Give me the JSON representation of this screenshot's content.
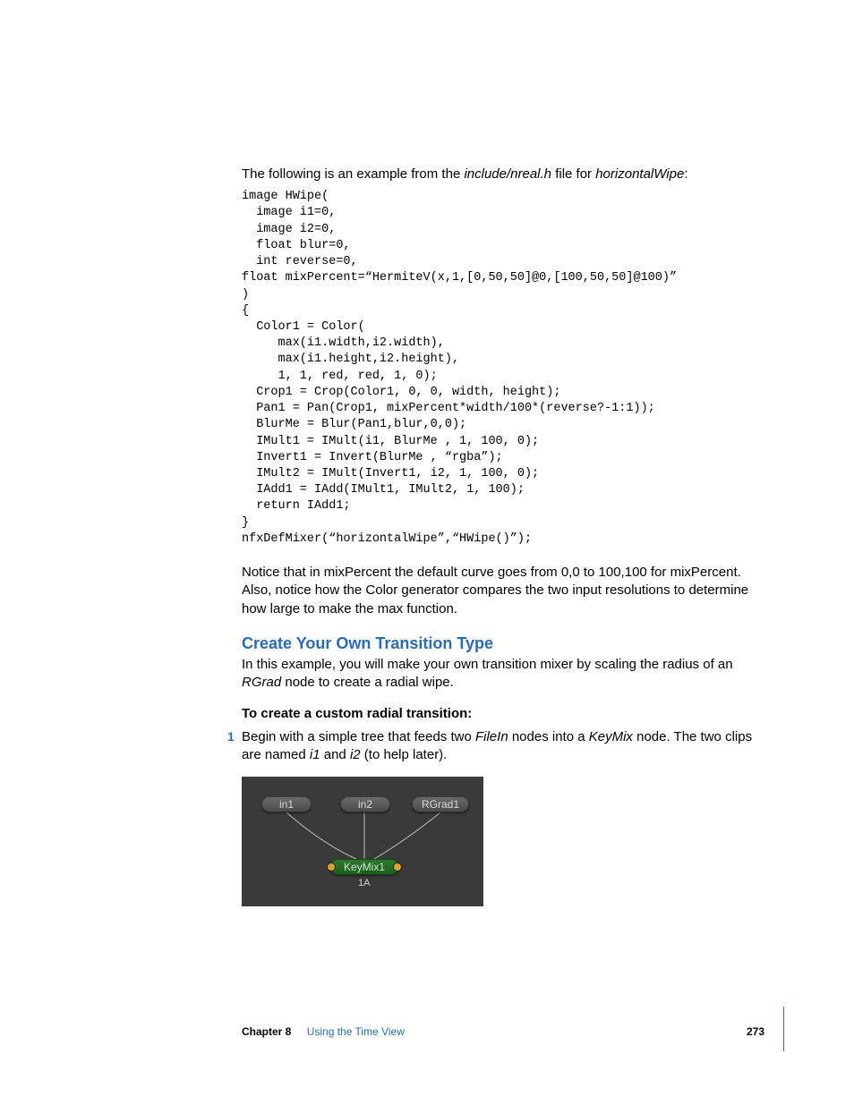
{
  "intro": {
    "prefix": "The following is an example from the ",
    "file_italic": "include/nreal.h",
    "mid": " file for ",
    "name_italic": "horizontalWipe",
    "suffix": ":"
  },
  "code": "image HWipe(\n  image i1=0,\n  image i2=0,\n  float blur=0,\n  int reverse=0,\nfloat mixPercent=“HermiteV(x,1,[0,50,50]@0,[100,50,50]@100)”\n)\n{\n  Color1 = Color(\n     max(i1.width,i2.width),\n     max(i1.height,i2.height),\n     1, 1, red, red, 1, 0);\n  Crop1 = Crop(Color1, 0, 0, width, height);\n  Pan1 = Pan(Crop1, mixPercent*width/100*(reverse?-1:1));\n  BlurMe = Blur(Pan1,blur,0,0);\n  IMult1 = IMult(i1, BlurMe , 1, 100, 0);\n  Invert1 = Invert(BlurMe , “rgba”);\n  IMult2 = IMult(Invert1, i2, 1, 100, 0);\n  IAdd1 = IAdd(IMult1, IMult2, 1, 100);\n  return IAdd1;\n}\nnfxDefMixer(“horizontalWipe”,“HWipe()”);",
  "notice": "Notice that in mixPercent the default curve goes from 0,0 to 100,100 for mixPercent. Also, notice how the Color generator compares the two input resolutions to determine how large to make the max function.",
  "section_head": "Create Your Own Transition Type",
  "section_body": {
    "before": "In this example, you will make your own transition mixer by scaling the radius of an ",
    "italic": "RGrad",
    "after": " node to create a radial wipe."
  },
  "step_head": "To create a custom radial transition:",
  "step1": {
    "num": "1",
    "p1a": "Begin with a simple tree that feeds two ",
    "p1_italic1": "FileIn",
    "p1b": " nodes into a ",
    "p1_italic2": "KeyMix",
    "p1c": " node. The two clips are named ",
    "p1_italic3": "i1",
    "p1d": " and ",
    "p1_italic4": "i2",
    "p1e": " (to help later)."
  },
  "figure": {
    "node_in1": "in1",
    "node_in2": "in2",
    "node_rgrad": "RGrad1",
    "node_keymix": "KeyMix1",
    "label_1a": "1A"
  },
  "footer": {
    "chapter": "Chapter 8",
    "title": "Using the Time View",
    "page": "273"
  }
}
